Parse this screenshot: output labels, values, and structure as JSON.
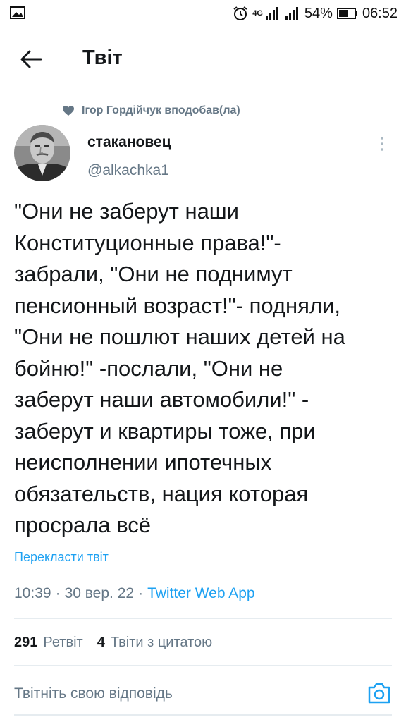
{
  "status_bar": {
    "network": "4G",
    "battery": "54%",
    "time": "06:52"
  },
  "header": {
    "title": "Твіт",
    "back_icon": "arrow-left-icon"
  },
  "social_context": {
    "icon": "heart-icon",
    "text": "Ігор Гордійчук вподобав(ла)"
  },
  "author": {
    "name": "стакановец",
    "handle": "@alkachka1"
  },
  "tweet": {
    "text": "\"Они не заберут наши\nКонституционные права!\"-\nзабрали, \"Они  не поднимут\nпенсионный возраст!\"- подняли,\n\"Они не пошлют наших детей на\nбойню!\" -послали, \"Они не\nзаберут наши автомобили!\" -\nзаберут и квартиры тоже, при\nнеисполнении ипотечных\nобязательств, нация которая\nпросрала всё",
    "translate_label": "Перекласти твіт",
    "time": "10:39",
    "date": "30 вер. 22",
    "source": "Twitter Web App"
  },
  "stats": {
    "retweets_count": "291",
    "retweets_label": "Ретвіт",
    "quotes_count": "4",
    "quotes_label": "Твіти з цитатою"
  },
  "reply": {
    "placeholder": "Твітніть свою відповідь",
    "camera_icon": "camera-icon"
  },
  "colors": {
    "accent": "#1da1f2",
    "secondary_text": "#657786",
    "divider": "#e6ecf0"
  }
}
